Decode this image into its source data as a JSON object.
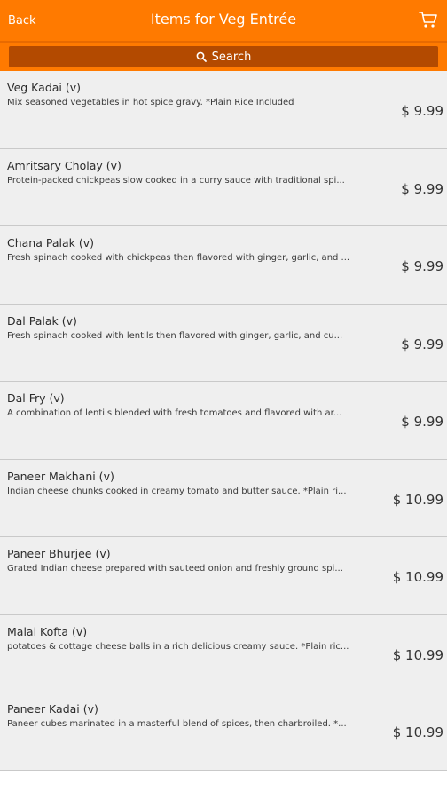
{
  "header": {
    "back_label": "Back",
    "title": "Items for Veg Entrée",
    "cart_icon": "cart-icon"
  },
  "search": {
    "label": "Search",
    "icon": "search-icon"
  },
  "colors": {
    "header_bg": "#ff7a00",
    "search_button_bg": "#b34a00",
    "list_bg": "#efefef"
  },
  "items": [
    {
      "name": "Veg Kadai (v)",
      "description": "Mix seasoned vegetables in hot spice gravy. *Plain Rice Included",
      "price": "$ 9.99"
    },
    {
      "name": "Amritsary Cholay (v)",
      "description": "Protein-packed chickpeas slow cooked in a curry sauce with traditional spi...",
      "price": "$ 9.99"
    },
    {
      "name": "Chana Palak (v)",
      "description": "Fresh spinach cooked with chickpeas then flavored with ginger, garlic, and ...",
      "price": "$ 9.99"
    },
    {
      "name": "Dal Palak (v)",
      "description": "Fresh spinach cooked with lentils then flavored with ginger, garlic, and cu...",
      "price": "$ 9.99"
    },
    {
      "name": "Dal Fry (v)",
      "description": "A combination of lentils blended with fresh tomatoes and flavored with ar...",
      "price": "$ 9.99"
    },
    {
      "name": "Paneer Makhani (v)",
      "description": "Indian cheese chunks cooked in creamy tomato and butter sauce. *Plain ri...",
      "price": "$ 10.99"
    },
    {
      "name": "Paneer Bhurjee (v)",
      "description": "Grated Indian cheese prepared with sauteed onion and freshly ground spi...",
      "price": "$ 10.99"
    },
    {
      "name": "Malai Kofta (v)",
      "description": "potatoes & cottage cheese balls in a rich delicious creamy sauce. *Plain ric...",
      "price": "$ 10.99"
    },
    {
      "name": "Paneer Kadai (v)",
      "description": "Paneer cubes marinated in a masterful blend of spices, then charbroiled. *...",
      "price": "$ 10.99"
    }
  ]
}
